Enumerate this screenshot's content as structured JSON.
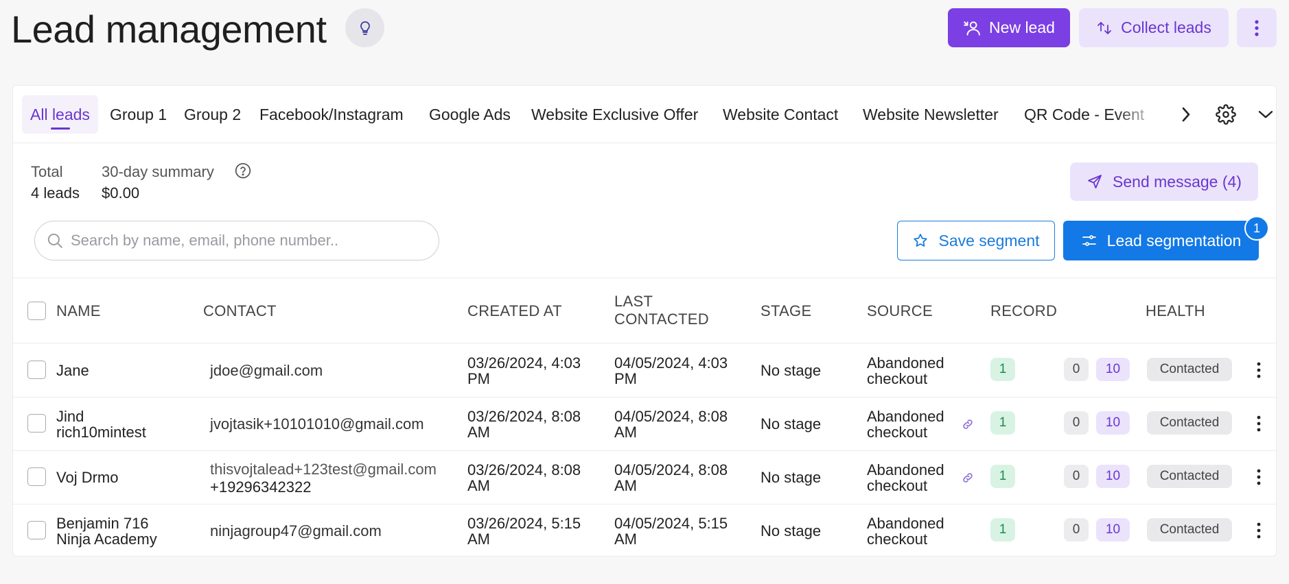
{
  "header": {
    "title": "Lead management",
    "new_lead_label": "New lead",
    "collect_leads_label": "Collect leads"
  },
  "tabs": [
    {
      "label": "All leads",
      "active": true
    },
    {
      "label": "Group 1"
    },
    {
      "label": "Group 2"
    },
    {
      "label": "Facebook/Instagram"
    },
    {
      "label": "Google Ads"
    },
    {
      "label": "Website Exclusive Offer"
    },
    {
      "label": "Website Contact"
    },
    {
      "label": "Website Newsletter"
    },
    {
      "label": "QR Code - Event"
    }
  ],
  "summary": {
    "total_label": "Total",
    "total_value": "4 leads",
    "period_label": "30-day summary",
    "period_value": "$0.00"
  },
  "actions": {
    "send_message_label": "Send message (4)",
    "save_segment_label": "Save segment",
    "lead_segmentation_label": "Lead segmentation",
    "segmentation_badge": "1"
  },
  "search": {
    "placeholder": "Search by name, email, phone number.."
  },
  "table": {
    "columns": {
      "name": "NAME",
      "contact": "CONTACT",
      "created_at": "CREATED AT",
      "last_contacted_1": "LAST",
      "last_contacted_2": "CONTACTED",
      "stage": "STAGE",
      "source": "SOURCE",
      "record": "RECORD",
      "health": "HEALTH"
    },
    "rows": [
      {
        "name_1": "Jane",
        "name_2": "",
        "contact_1": "jdoe@gmail.com",
        "contact_2": "",
        "created_1": "03/26/2024, 4:03",
        "created_2": "PM",
        "last_1": "04/05/2024, 4:03",
        "last_2": "PM",
        "stage": "No stage",
        "source_1": "Abandoned",
        "source_2": "checkout",
        "record_a": "1",
        "record_b": "0",
        "record_c": "10",
        "health": "Contacted"
      },
      {
        "name_1": "Jind",
        "name_2": "rich10mintest",
        "contact_1": "jvojtasik+10101010@gmail.com",
        "contact_2": "",
        "created_1": "03/26/2024, 8:08",
        "created_2": "AM",
        "last_1": "04/05/2024, 8:08",
        "last_2": "AM",
        "stage": "No stage",
        "source_1": "Abandoned",
        "source_2": "checkout",
        "record_a": "1",
        "record_b": "0",
        "record_c": "10",
        "health": "Contacted"
      },
      {
        "name_1": "Voj Drmo",
        "name_2": "",
        "contact_1": "thisvojtalead+123test@gmail.com",
        "contact_2": "+19296342322",
        "created_1": "03/26/2024, 8:08",
        "created_2": "AM",
        "last_1": "04/05/2024, 8:08",
        "last_2": "AM",
        "stage": "No stage",
        "source_1": "Abandoned",
        "source_2": "checkout",
        "record_a": "1",
        "record_b": "0",
        "record_c": "10",
        "health": "Contacted"
      },
      {
        "name_1": "Benjamin 716",
        "name_2": "Ninja Academy",
        "contact_1": "ninjagroup47@gmail.com",
        "contact_2": "",
        "created_1": "03/26/2024, 5:15",
        "created_2": "AM",
        "last_1": "04/05/2024, 5:15",
        "last_2": "AM",
        "stage": "No stage",
        "source_1": "Abandoned",
        "source_2": "checkout",
        "record_a": "1",
        "record_b": "0",
        "record_c": "10",
        "health": "Contacted"
      }
    ]
  },
  "colors": {
    "primary_purple": "#7b3fe4",
    "soft_purple": "#ebe3fb",
    "blue": "#1379e6",
    "green_pill": "#d8f3e3"
  },
  "icons": [
    "lightbulb-icon",
    "add-person-icon",
    "swap-arrows-icon",
    "kebab-icon",
    "chevron-right-icon",
    "gear-icon",
    "chevron-down-icon",
    "help-circle-icon",
    "send-icon",
    "search-icon",
    "star-icon",
    "sliders-icon",
    "link-icon"
  ]
}
